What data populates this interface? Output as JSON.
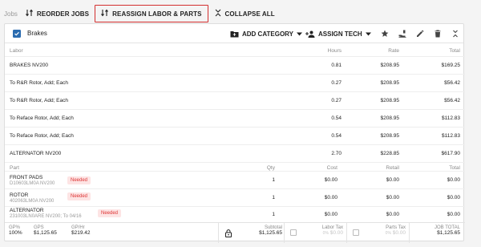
{
  "toolbar": {
    "jobs_label": "Jobs",
    "reorder_label": "REORDER JOBS",
    "reassign_label": "REASSIGN LABOR & PARTS",
    "collapse_label": "COLLAPSE ALL"
  },
  "job": {
    "title": "Brakes",
    "add_category_label": "ADD CATEGORY",
    "assign_tech_label": "ASSIGN TECH",
    "icons": [
      "star-icon",
      "tech-hand-icon",
      "edit-icon",
      "delete-icon",
      "collapse-icon"
    ]
  },
  "labor_headers": {
    "name": "Labor",
    "hours": "Hours",
    "rate": "Rate",
    "total": "Total"
  },
  "labor": [
    {
      "name": "BRAKES NV200",
      "hours": "0.81",
      "rate": "$208.95",
      "total": "$169.25"
    },
    {
      "name": "To R&R Rotor, Add; Each",
      "hours": "0.27",
      "rate": "$208.95",
      "total": "$56.42"
    },
    {
      "name": "To R&R Rotor, Add; Each",
      "hours": "0.27",
      "rate": "$208.95",
      "total": "$56.42"
    },
    {
      "name": "To Reface Rotor, Add; Each",
      "hours": "0.54",
      "rate": "$208.95",
      "total": "$112.83"
    },
    {
      "name": "To Reface Rotor, Add; Each",
      "hours": "0.54",
      "rate": "$208.95",
      "total": "$112.83"
    },
    {
      "name": "ALTERNATOR NV200",
      "hours": "2.70",
      "rate": "$228.85",
      "total": "$617.90"
    }
  ],
  "part_headers": {
    "name": "Part",
    "qty": "Qty",
    "cost": "Cost",
    "retail": "Retail",
    "total": "Total"
  },
  "parts": [
    {
      "name": "FRONT PADS",
      "sub": "D10603LM0A NV200",
      "badge": "Needed",
      "qty": "1",
      "cost": "$0.00",
      "retail": "$0.00",
      "total": "$0.00"
    },
    {
      "name": "ROTOR",
      "sub": "402063LM0A NV200",
      "badge": "Needed",
      "qty": "1",
      "cost": "$0.00",
      "retail": "$0.00",
      "total": "$0.00"
    },
    {
      "name": "ALTERNATOR",
      "sub": "231003LN0ARE NV200; To 04/16",
      "badge": "Needed",
      "qty": "1",
      "cost": "$0.00",
      "retail": "$0.00",
      "total": "$0.00"
    }
  ],
  "footer": {
    "gp_pct_label": "GP%",
    "gp_pct_value": "100%",
    "gps_label": "GPS",
    "gps_value": "$1,125.65",
    "gphr_label": "GP/Hr",
    "gphr_value": "$219.42",
    "subtotal_label": "Subtotal",
    "subtotal_value": "$1,125.65",
    "labor_tax_label": "Labor Tax",
    "labor_tax_pct": "0%",
    "labor_tax_value": "$0.00",
    "parts_tax_label": "Parts Tax",
    "parts_tax_pct": "0%",
    "parts_tax_value": "$0.00",
    "job_total_label": "JOB TOTAL",
    "job_total_value": "$1,125.65"
  }
}
